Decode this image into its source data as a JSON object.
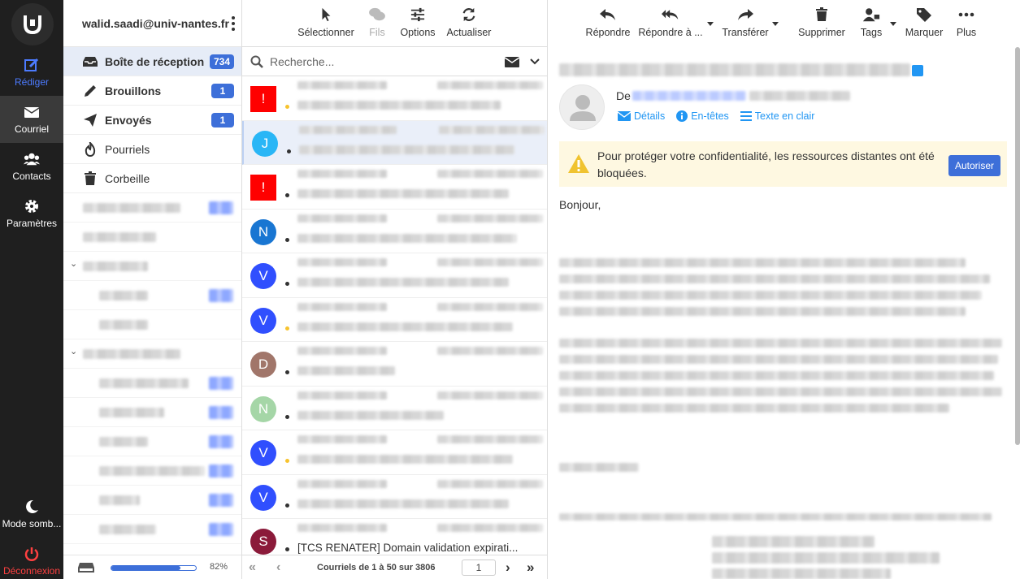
{
  "nav": {
    "compose": "Rédiger",
    "mail": "Courriel",
    "contacts": "Contacts",
    "settings": "Paramètres",
    "darkmode": "Mode somb...",
    "logout": "Déconnexion"
  },
  "account": {
    "email": "walid.saadi@univ-nantes.fr"
  },
  "folders": [
    {
      "label": "Boîte de réception",
      "count": "734"
    },
    {
      "label": "Brouillons",
      "count": "1"
    },
    {
      "label": "Envoyés",
      "count": "1"
    },
    {
      "label": "Pourriels",
      "count": ""
    },
    {
      "label": "Corbeille",
      "count": ""
    }
  ],
  "quota": {
    "percent": "82%",
    "fraction": 0.82
  },
  "list_toolbar": {
    "select": "Sélectionner",
    "threads": "Fils",
    "options": "Options",
    "refresh": "Actualiser"
  },
  "search": {
    "placeholder": "Recherche..."
  },
  "messages": [
    {
      "initial": "!",
      "color": "#ff0000",
      "flag": true,
      "dot": "#f7c32e"
    },
    {
      "initial": "J",
      "color": "#29b6f6",
      "flag": false,
      "dot": "#333333"
    },
    {
      "initial": "!",
      "color": "#ff0000",
      "flag": true,
      "dot": "#333333"
    },
    {
      "initial": "N",
      "color": "#1976d2",
      "flag": false,
      "dot": "#333333"
    },
    {
      "initial": "V",
      "color": "#304ffe",
      "flag": false,
      "dot": "#333333"
    },
    {
      "initial": "V",
      "color": "#304ffe",
      "flag": false,
      "dot": "#f7c32e"
    },
    {
      "initial": "D",
      "color": "#a1766a",
      "flag": false,
      "dot": "#333333"
    },
    {
      "initial": "N",
      "color": "#a5d6a7",
      "flag": false,
      "dot": "#333333"
    },
    {
      "initial": "V",
      "color": "#304ffe",
      "flag": false,
      "dot": "#f7c32e"
    },
    {
      "initial": "V",
      "color": "#304ffe",
      "flag": false,
      "dot": "#333333"
    },
    {
      "initial": "S",
      "color": "#8b1a3a",
      "flag": false,
      "dot": "#333333",
      "subject": "[TCS RENATER] Domain validation expirati..."
    }
  ],
  "pagination": {
    "summary": "Courriels de 1 à 50 sur 3806",
    "page": "1"
  },
  "reader_toolbar": {
    "reply": "Répondre",
    "reply_all": "Répondre à ...",
    "forward": "Transférer",
    "delete": "Supprimer",
    "tags": "Tags",
    "mark": "Marquer",
    "more": "Plus"
  },
  "header": {
    "from_label": "De",
    "details": "Détails",
    "headers": "En-têtes",
    "plain": "Texte en clair"
  },
  "privacy": {
    "text": "Pour protéger votre confidentialité, les ressources distantes ont été bloquées.",
    "allow": "Autoriser"
  },
  "body": {
    "greeting": "Bonjour,"
  }
}
